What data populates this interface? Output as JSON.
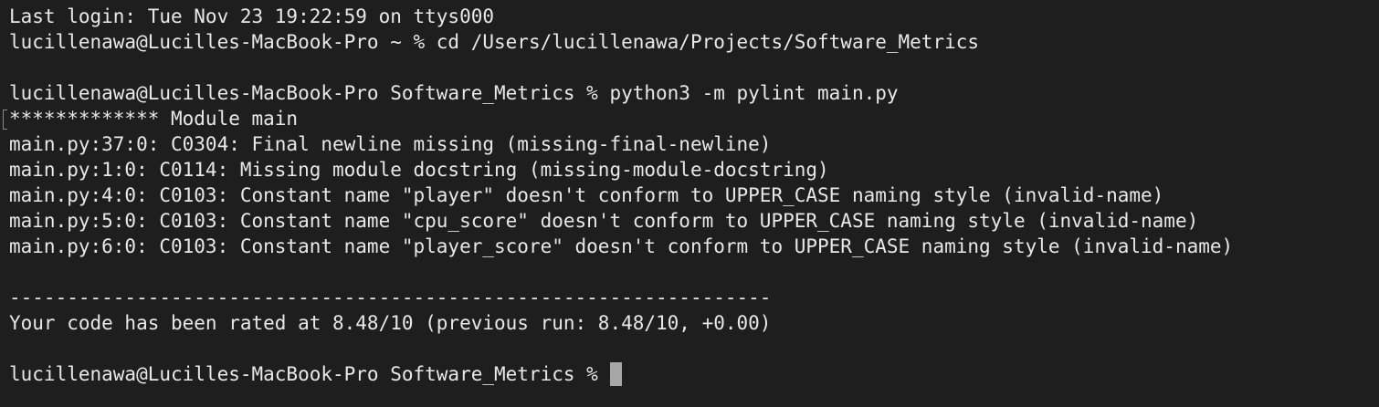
{
  "terminal": {
    "lines": [
      "Last login: Tue Nov 23 19:22:59 on ttys000",
      "lucillenawa@Lucilles-MacBook-Pro ~ % cd /Users/lucillenawa/Projects/Software_Metrics",
      "",
      "lucillenawa@Lucilles-MacBook-Pro Software_Metrics % python3 -m pylint main.py",
      "************* Module main",
      "main.py:37:0: C0304: Final newline missing (missing-final-newline)",
      "main.py:1:0: C0114: Missing module docstring (missing-module-docstring)",
      "main.py:4:0: C0103: Constant name \"player\" doesn't conform to UPPER_CASE naming style (invalid-name)",
      "main.py:5:0: C0103: Constant name \"cpu_score\" doesn't conform to UPPER_CASE naming style (invalid-name)",
      "main.py:6:0: C0103: Constant name \"player_score\" doesn't conform to UPPER_CASE naming style (invalid-name)",
      "",
      "------------------------------------------------------------------",
      "Your code has been rated at 8.48/10 (previous run: 8.48/10, +0.00)",
      ""
    ],
    "prompt": "lucillenawa@Lucilles-MacBook-Pro Software_Metrics % "
  },
  "colors": {
    "background": "#1e1e1e",
    "text": "#e8e8e8",
    "cursor": "#a7a7a7"
  }
}
